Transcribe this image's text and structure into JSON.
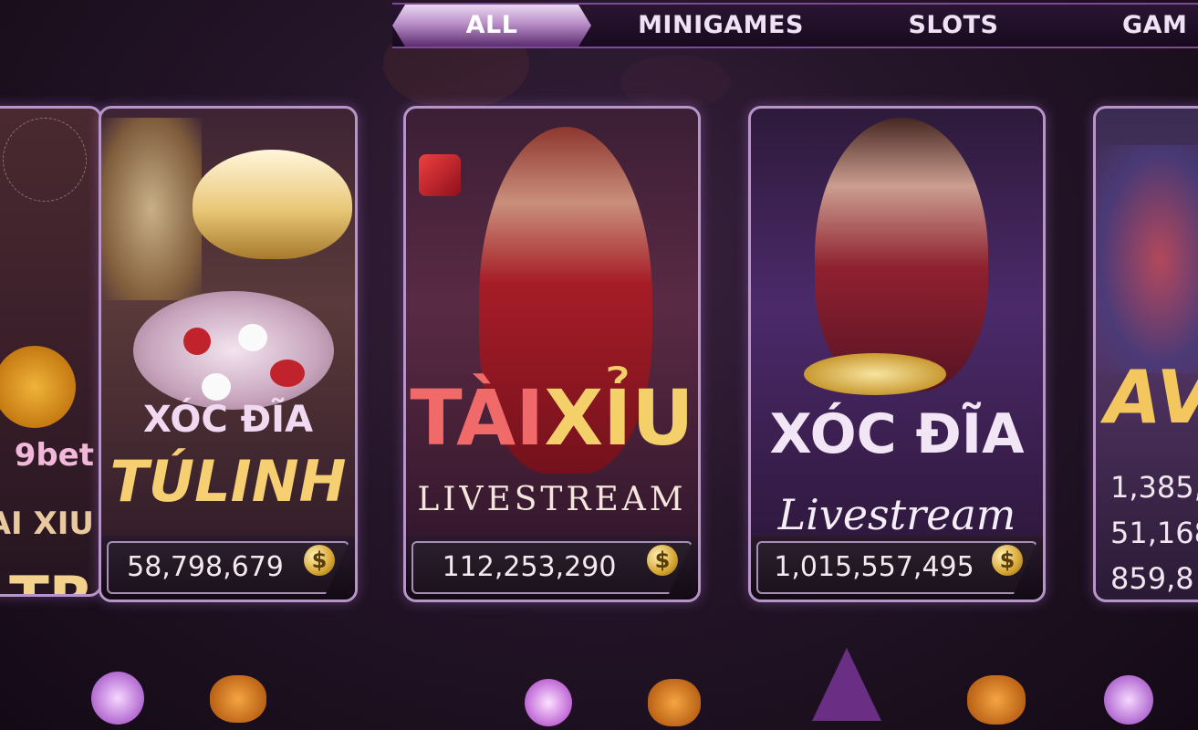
{
  "tabs": [
    {
      "label": "ALL",
      "active": true
    },
    {
      "label": "MINIGAMES",
      "active": false
    },
    {
      "label": "SLOTS",
      "active": false
    },
    {
      "label": "GAM",
      "active": false
    }
  ],
  "cards": {
    "partial_left": {
      "brand": "9bet",
      "line1": "AI XIU",
      "line2": "TR"
    },
    "xoc_dia_tu_linh": {
      "title_top": "XÓC ĐĨA",
      "title_bottom": "TÚLINH",
      "jackpot": "58,798,679"
    },
    "tai_xiu_livestream": {
      "title_top_a": "TÀI",
      "title_top_b": "XỈU",
      "title_bottom": "LIVESTREAM",
      "jackpot": "112,253,290"
    },
    "xoc_dia_livestream": {
      "title_top": "XÓC ĐĨA",
      "title_bottom": "Livestream",
      "jackpot": "1,015,557,495"
    },
    "avengers_partial": {
      "title": "AV",
      "values": [
        "1,385,",
        "51,168",
        "859,8"
      ]
    }
  },
  "icons": {
    "coin": "dollar-coin-icon",
    "dice": "dice-icon"
  },
  "colors": {
    "accent": "#b795c9",
    "tab_active": "#b98fc8",
    "gold": "#e9c25a"
  }
}
